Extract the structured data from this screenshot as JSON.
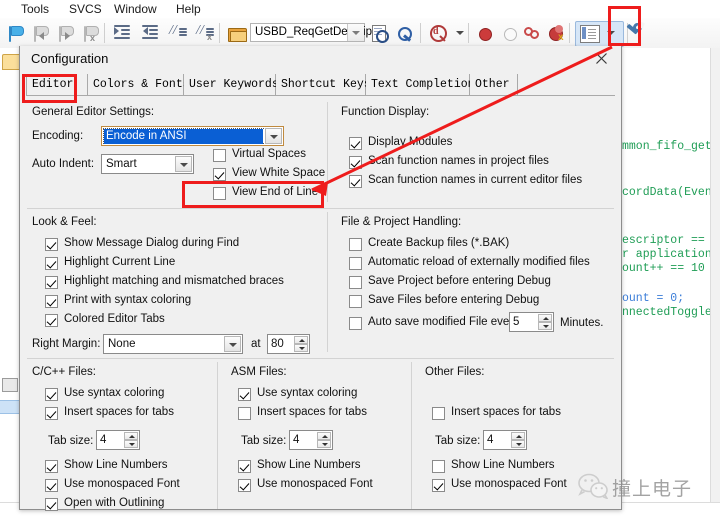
{
  "menubar": {
    "items": [
      "Tools",
      "SVCS",
      "Window",
      "Help"
    ]
  },
  "toolbar": {
    "icons": [
      {
        "name": "bookmark-toggle-icon",
        "label": "Toggle Bookmark"
      },
      {
        "name": "bookmark-prev-icon",
        "label": "Previous Bookmark"
      },
      {
        "name": "bookmark-next-icon",
        "label": "Next Bookmark"
      },
      {
        "name": "bookmark-clear-icon",
        "label": "Clear All Bookmarks"
      },
      {
        "name": "indent-increase-icon",
        "label": "Indent Selected Text"
      },
      {
        "name": "indent-decrease-icon",
        "label": "Unindent Selected Text"
      },
      {
        "name": "comment-icon",
        "label": "Comment Selection"
      },
      {
        "name": "uncomment-icon",
        "label": "Uncomment Selection"
      },
      {
        "name": "open-folder-icon",
        "label": "Open File"
      }
    ],
    "function_combo_value": "USBD_ReqGetDescriptor",
    "right_icons": [
      {
        "name": "browse-symbol-icon",
        "label": "Browse Symbol"
      },
      {
        "name": "goto-definition-icon",
        "label": "Go To Definition"
      },
      {
        "name": "find-in-files-icon",
        "label": "Find In Files"
      },
      {
        "name": "breakpoint-insert-icon",
        "label": "Insert/Remove Breakpoint"
      },
      {
        "name": "breakpoint-enable-icon",
        "label": "Enable/Disable Breakpoint"
      },
      {
        "name": "breakpoint-disable-all-icon",
        "label": "Disable All Breakpoints"
      },
      {
        "name": "breakpoint-kill-all-icon",
        "label": "Kill All Breakpoints"
      },
      {
        "name": "manage-windows-icon",
        "label": "Manage Components"
      },
      {
        "name": "configuration-wrench-icon",
        "label": "Configuration"
      }
    ]
  },
  "dialog": {
    "title": "Configuration",
    "close_label": "Close",
    "tabs": [
      {
        "label": "Editor",
        "selected": true
      },
      {
        "label": "Colors & Fonts",
        "selected": false
      },
      {
        "label": "User Keywords",
        "selected": false
      },
      {
        "label": "Shortcut Keys",
        "selected": false
      },
      {
        "label": "Text Completion",
        "selected": false
      },
      {
        "label": "Other",
        "selected": false
      }
    ],
    "general_editor_settings": {
      "title": "General Editor Settings:",
      "encoding_label": "Encoding:",
      "encoding_value": "Encode in ANSI",
      "auto_indent_label": "Auto Indent:",
      "auto_indent_value": "Smart",
      "checkboxes": [
        {
          "label": "Virtual Spaces",
          "checked": false
        },
        {
          "label": "View White Space",
          "checked": true
        },
        {
          "label": "View End of Line",
          "checked": false
        }
      ]
    },
    "function_display": {
      "title": "Function Display:",
      "checkboxes": [
        {
          "label": "Display Modules",
          "checked": true
        },
        {
          "label": "Scan function names in project files",
          "checked": true
        },
        {
          "label": "Scan function names in current editor files",
          "checked": true
        }
      ]
    },
    "look_and_feel": {
      "title": "Look & Feel:",
      "checkboxes": [
        {
          "label": "Show Message Dialog during Find",
          "checked": true
        },
        {
          "label": "Highlight Current Line",
          "checked": true
        },
        {
          "label": "Highlight matching and mismatched braces",
          "checked": true
        },
        {
          "label": "Print with syntax coloring",
          "checked": true
        },
        {
          "label": "Colored Editor Tabs",
          "checked": true
        }
      ],
      "right_margin_label": "Right Margin:",
      "right_margin_value": "None",
      "at_label": "at",
      "at_value": "80"
    },
    "file_project_handling": {
      "title": "File & Project Handling:",
      "checkboxes": [
        {
          "label": "Create Backup files (*.BAK)",
          "checked": false
        },
        {
          "label": "Automatic reload of externally modified files",
          "checked": false
        },
        {
          "label": "Save Project before entering Debug",
          "checked": false
        },
        {
          "label": "Save Files before entering Debug",
          "checked": false
        }
      ],
      "auto_save_label": "Auto save modified File every",
      "auto_save_checked": false,
      "auto_save_value": "5",
      "auto_save_unit": "Minutes."
    },
    "c_cpp_files": {
      "title": "C/C++ Files:",
      "checkboxes_top": [
        {
          "label": "Use syntax coloring",
          "checked": true
        },
        {
          "label": "Insert spaces for tabs",
          "checked": true
        }
      ],
      "tab_size_label": "Tab size:",
      "tab_size_value": "4",
      "checkboxes_bottom": [
        {
          "label": "Show Line Numbers",
          "checked": true
        },
        {
          "label": "Use monospaced Font",
          "checked": true
        },
        {
          "label": "Open with Outlining",
          "checked": true
        }
      ]
    },
    "asm_files": {
      "title": "ASM Files:",
      "checkboxes_top": [
        {
          "label": "Use syntax coloring",
          "checked": true
        },
        {
          "label": "Insert spaces for tabs",
          "checked": false
        }
      ],
      "tab_size_label": "Tab size:",
      "tab_size_value": "4",
      "checkboxes_bottom": [
        {
          "label": "Show Line Numbers",
          "checked": true
        },
        {
          "label": "Use monospaced Font",
          "checked": true
        }
      ]
    },
    "other_files": {
      "title": "Other Files:",
      "checkboxes_top": [
        {
          "label": "Insert spaces for tabs",
          "checked": false
        }
      ],
      "tab_size_label": "Tab size:",
      "tab_size_value": "4",
      "checkboxes_bottom": [
        {
          "label": "Show Line Numbers",
          "checked": false
        },
        {
          "label": "Use monospaced Font",
          "checked": true
        }
      ]
    }
  },
  "annotations": {
    "color": "#ee1c1c",
    "boxes": [
      {
        "name": "wrench-button-highlight"
      },
      {
        "name": "editor-tab-highlight"
      },
      {
        "name": "view-white-space-highlight"
      }
    ],
    "arrow": {
      "name": "pointer-arrow",
      "from": "wrench-button",
      "to": "view-white-space-checkbox"
    }
  },
  "editor_background": {
    "lines": [
      "mmon_fifo_get",
      "cordData(Even",
      "escriptor ==",
      "r application",
      "ount++ == 10",
      "ount = 0;",
      "nnectedToggle"
    ]
  },
  "watermark": {
    "text": "撞上电子",
    "logo": "wechat-logo"
  }
}
